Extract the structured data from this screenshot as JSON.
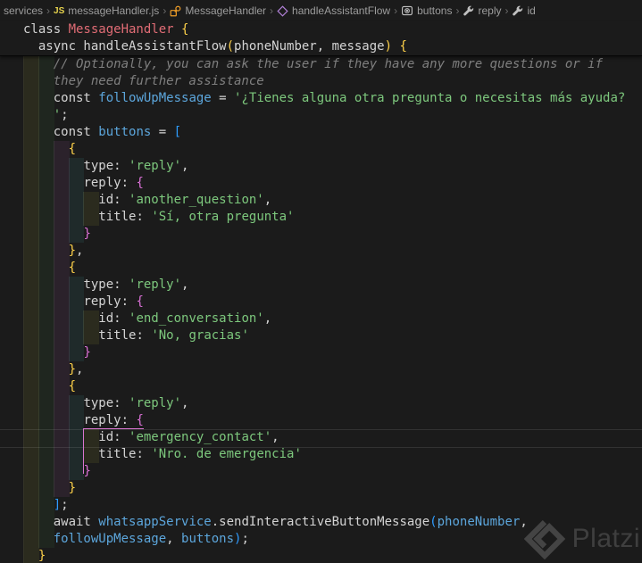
{
  "breadcrumb": {
    "separator": "›",
    "items": [
      {
        "label": "services",
        "icon": null
      },
      {
        "label": "messageHandler.js",
        "icon": "js-file-icon"
      },
      {
        "label": "MessageHandler",
        "icon": "class-icon"
      },
      {
        "label": "handleAssistantFlow",
        "icon": "method-icon"
      },
      {
        "label": "buttons",
        "icon": "object-icon"
      },
      {
        "label": "reply",
        "icon": "property-wrench-icon"
      },
      {
        "label": "id",
        "icon": "property-wrench-icon"
      }
    ]
  },
  "code": {
    "sticky_rows": [
      {
        "ind": 0,
        "t": [
          [
            "d",
            "class "
          ],
          [
            "r",
            "MessageHandler"
          ],
          [
            "d",
            " "
          ],
          [
            "y",
            "{"
          ]
        ]
      },
      {
        "ind": 2,
        "t": [
          [
            "d",
            "async handleAssistantFlow"
          ],
          [
            "y",
            "("
          ],
          [
            "d",
            "phoneNumber, message"
          ],
          [
            "y",
            ")"
          ],
          [
            "d",
            " "
          ],
          [
            "y",
            "{"
          ]
        ]
      }
    ],
    "rows": [
      {
        "ind": 4,
        "t": [
          [
            "c",
            "// Optionally, you can ask the user if they have any more questions or if"
          ]
        ]
      },
      {
        "ind": 4,
        "t": [
          [
            "c",
            "they need further assistance"
          ]
        ]
      },
      {
        "ind": 4,
        "t": [
          [
            "d",
            "const "
          ],
          [
            "b",
            "followUpMessage"
          ],
          [
            "d",
            " = "
          ],
          [
            "g",
            "'¿Tienes alguna otra pregunta o necesitas más ayuda?"
          ]
        ]
      },
      {
        "ind": 4,
        "t": [
          [
            "g",
            "'"
          ],
          [
            "d",
            ";"
          ]
        ]
      },
      {
        "ind": 4,
        "t": [
          [
            "d",
            "const "
          ],
          [
            "b",
            "buttons"
          ],
          [
            "d",
            " = "
          ],
          [
            "u",
            "["
          ]
        ]
      },
      {
        "ind": 6,
        "t": [
          [
            "y",
            "{"
          ]
        ]
      },
      {
        "ind": 8,
        "t": [
          [
            "d",
            "type: "
          ],
          [
            "g",
            "'reply'"
          ],
          [
            "d",
            ","
          ]
        ]
      },
      {
        "ind": 8,
        "t": [
          [
            "d",
            "reply: "
          ],
          [
            "p",
            "{"
          ]
        ]
      },
      {
        "ind": 10,
        "t": [
          [
            "d",
            "id: "
          ],
          [
            "g",
            "'another_question'"
          ],
          [
            "d",
            ","
          ]
        ]
      },
      {
        "ind": 10,
        "t": [
          [
            "d",
            "title: "
          ],
          [
            "g",
            "'Sí, otra pregunta'"
          ]
        ]
      },
      {
        "ind": 8,
        "t": [
          [
            "p",
            "}"
          ]
        ]
      },
      {
        "ind": 6,
        "t": [
          [
            "y",
            "}"
          ],
          [
            "d",
            ","
          ]
        ]
      },
      {
        "ind": 6,
        "t": [
          [
            "y",
            "{"
          ]
        ]
      },
      {
        "ind": 8,
        "t": [
          [
            "d",
            "type: "
          ],
          [
            "g",
            "'reply'"
          ],
          [
            "d",
            ","
          ]
        ]
      },
      {
        "ind": 8,
        "t": [
          [
            "d",
            "reply: "
          ],
          [
            "p",
            "{"
          ]
        ]
      },
      {
        "ind": 10,
        "t": [
          [
            "d",
            "id: "
          ],
          [
            "g",
            "'end_conversation'"
          ],
          [
            "d",
            ","
          ]
        ]
      },
      {
        "ind": 10,
        "t": [
          [
            "d",
            "title: "
          ],
          [
            "g",
            "'No, gracias'"
          ]
        ]
      },
      {
        "ind": 8,
        "t": [
          [
            "p",
            "}"
          ]
        ]
      },
      {
        "ind": 6,
        "t": [
          [
            "y",
            "}"
          ],
          [
            "d",
            ","
          ]
        ]
      },
      {
        "ind": 6,
        "t": [
          [
            "y",
            "{"
          ]
        ]
      },
      {
        "ind": 8,
        "t": [
          [
            "d",
            "type: "
          ],
          [
            "g",
            "'reply'"
          ],
          [
            "d",
            ","
          ]
        ]
      },
      {
        "ind": 8,
        "t": [
          [
            "d",
            "reply: "
          ],
          [
            "p",
            "{"
          ]
        ]
      },
      {
        "ind": 10,
        "t": [
          [
            "d",
            "id: "
          ],
          [
            "g",
            "'emergency_contact'"
          ],
          [
            "d",
            ","
          ]
        ]
      },
      {
        "ind": 10,
        "t": [
          [
            "d",
            "title: "
          ],
          [
            "g",
            "'Nro. de emergencia'"
          ]
        ]
      },
      {
        "ind": 8,
        "t": [
          [
            "p",
            "}"
          ]
        ]
      },
      {
        "ind": 6,
        "t": [
          [
            "y",
            "}"
          ]
        ]
      },
      {
        "ind": 4,
        "t": [
          [
            "u",
            "]"
          ],
          [
            "d",
            ";"
          ]
        ]
      },
      {
        "ind": 4,
        "t": [
          [
            "d",
            "await "
          ],
          [
            "b",
            "whatsappService"
          ],
          [
            "d",
            ".sendInteractiveButtonMessage"
          ],
          [
            "u",
            "("
          ],
          [
            "b",
            "phoneNumber"
          ],
          [
            "d",
            ","
          ]
        ]
      },
      {
        "ind": 4,
        "t": [
          [
            "b",
            "followUpMessage"
          ],
          [
            "d",
            ", "
          ],
          [
            "b",
            "buttons"
          ],
          [
            "u",
            ")"
          ],
          [
            "d",
            ";"
          ]
        ]
      },
      {
        "ind": 2,
        "t": [
          [
            "y",
            "}"
          ]
        ]
      }
    ],
    "current_line": {
      "row": 22
    },
    "active_bracket_guide": {
      "open_row": 21,
      "close_row": 24,
      "col": 8,
      "underline_chars": 8
    }
  },
  "watermark": {
    "text": "Platzi"
  },
  "colors": {
    "background": "#1b1b1b",
    "breadcrumb_text": "#9d9d9d",
    "token": {
      "d": "#d4d4d4",
      "r": "#e06c75",
      "b": "#5ca6dc",
      "g": "#7dc87d",
      "c": "#7f7f7f",
      "y": "#ffd24a",
      "p": "#da70d6",
      "u": "#2e9cff"
    },
    "indent_tints": [
      "rgba(255,255,64,0.07)",
      "rgba(127,255,127,0.05)",
      "rgba(255,127,255,0.07)",
      "rgba(79,236,236,0.07)"
    ],
    "current_line_border": "rgba(255,255,255,0.10)",
    "bracket_guide": "#d975d0",
    "icon_class": "#ee9d28",
    "icon_method": "#b180d7",
    "icon_file_js": "#e8d44d",
    "icon_symbol": "#c0c0c0"
  }
}
